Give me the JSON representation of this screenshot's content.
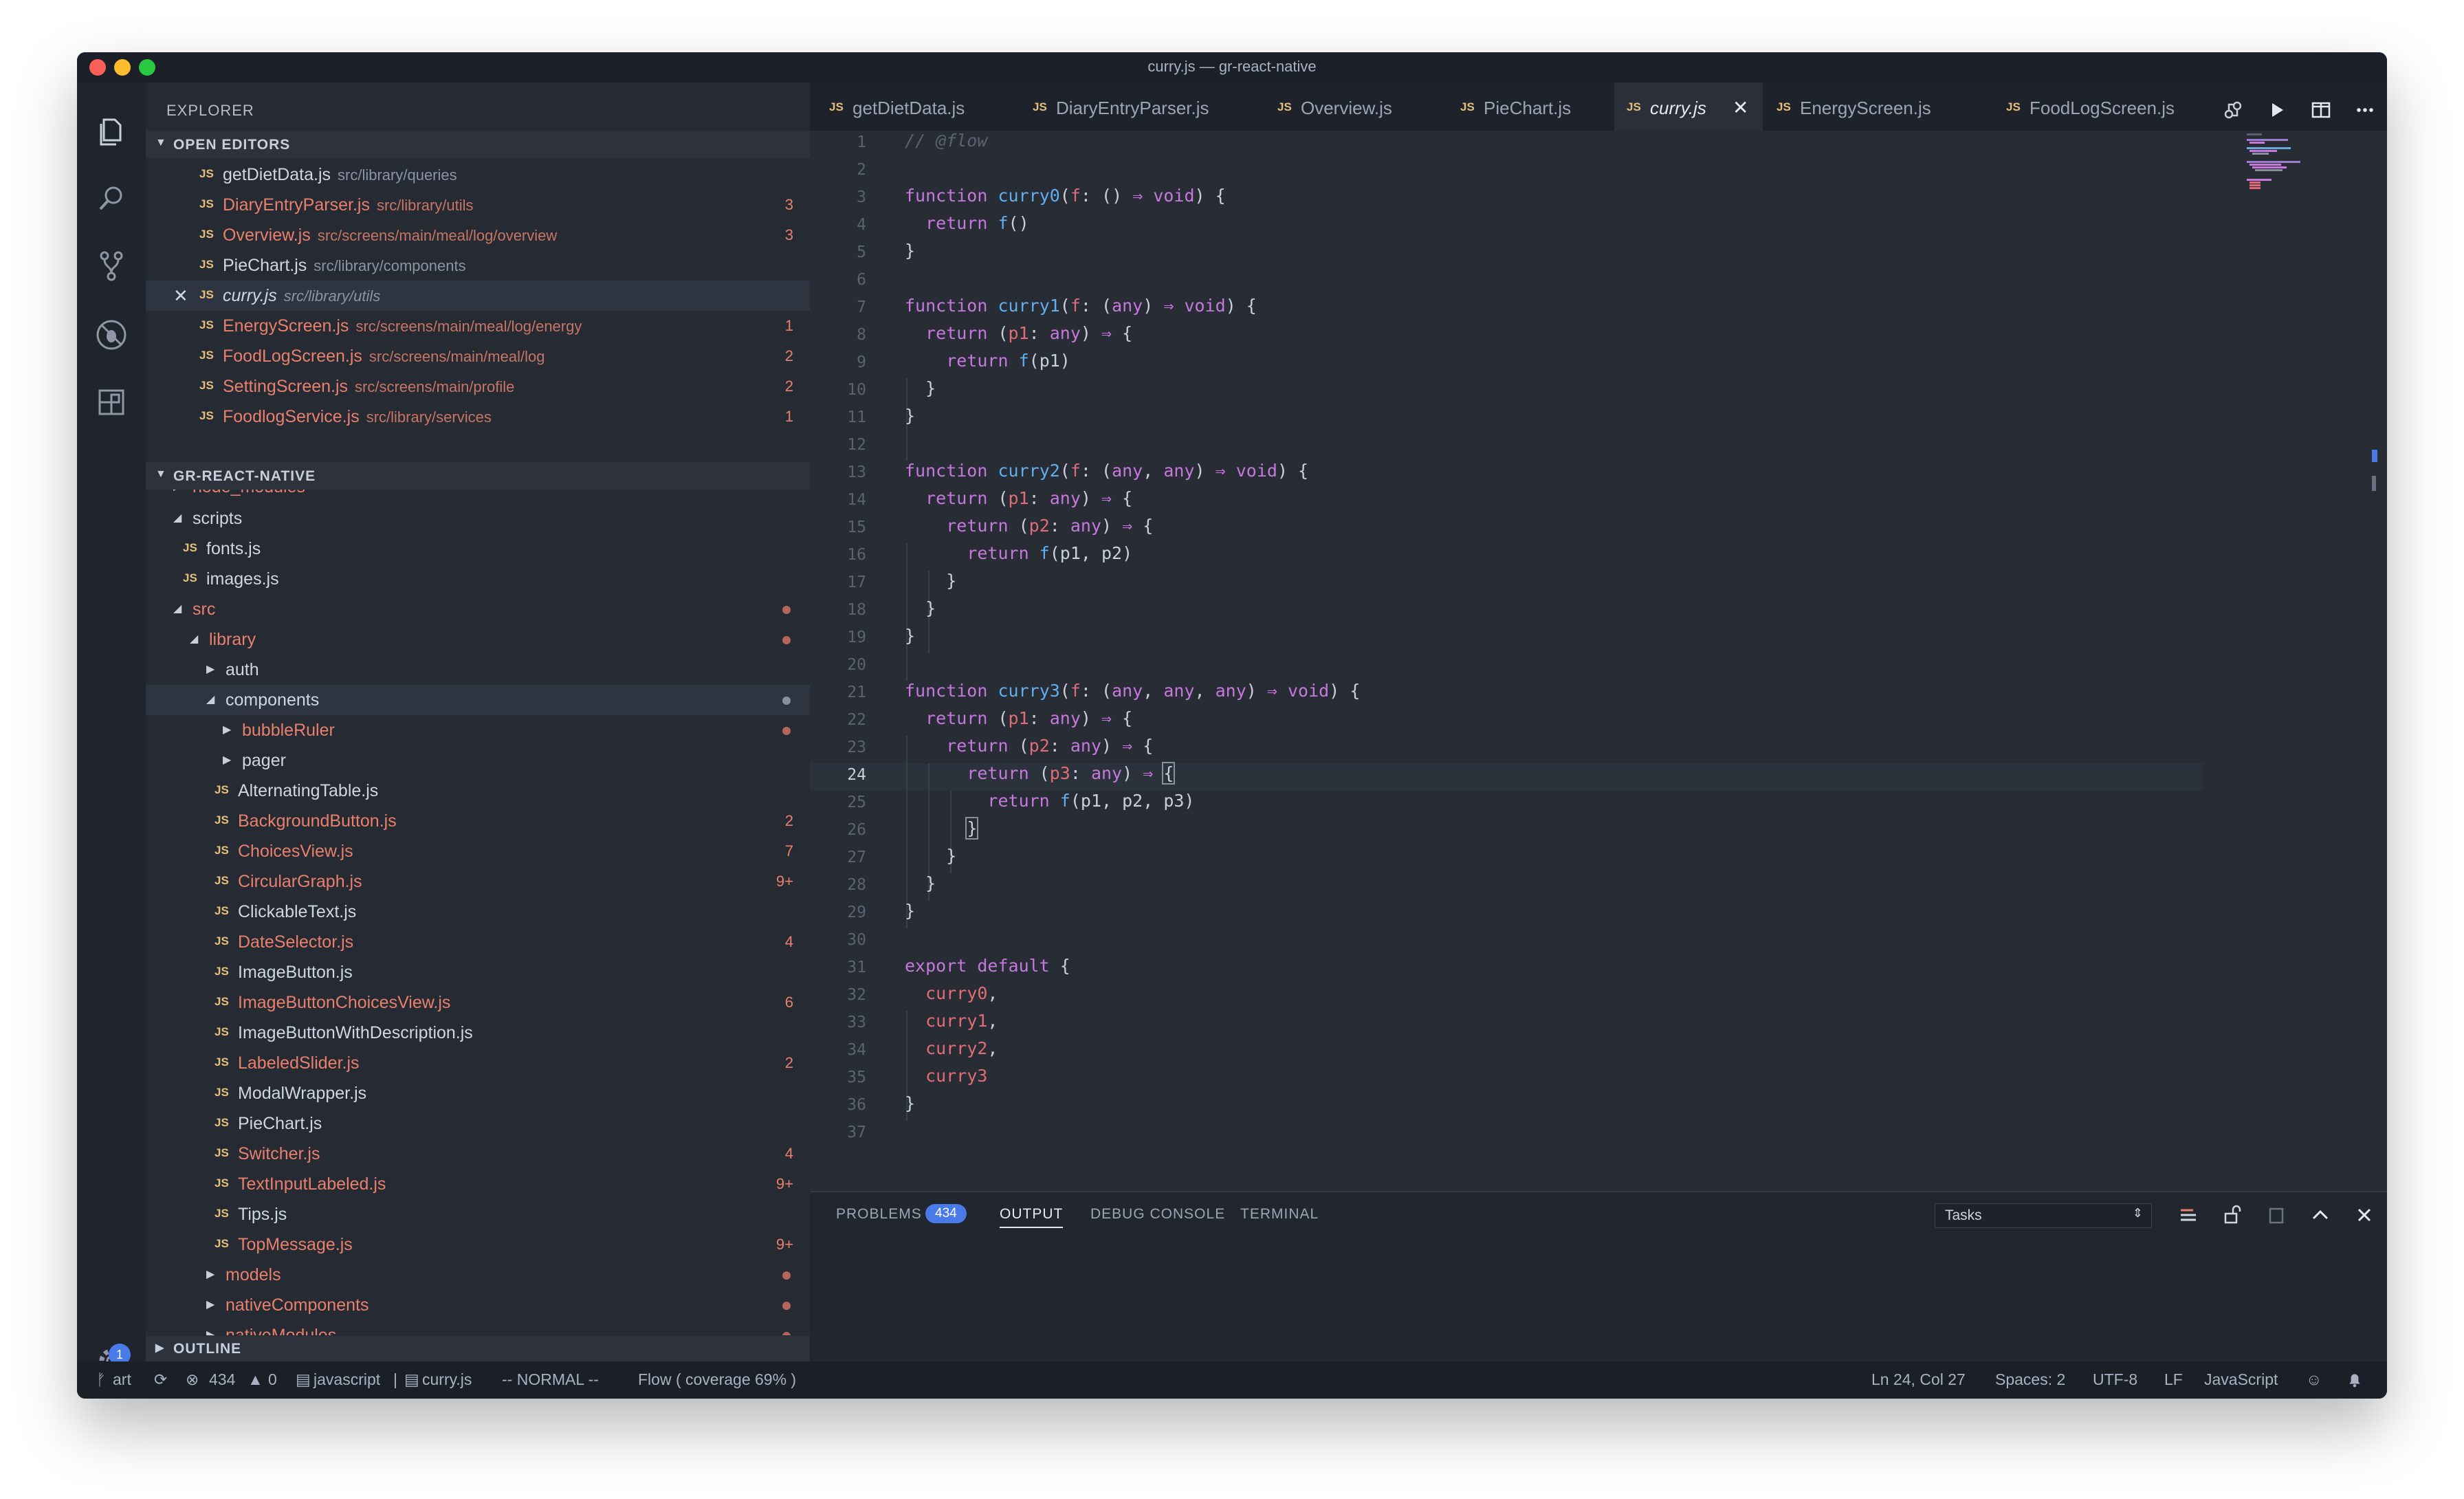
{
  "window": {
    "title": "curry.js — gr-react-native"
  },
  "colors": {
    "accent": "#4a7ae8",
    "modified": "#e8806d",
    "js_icon": "#e5c07b"
  },
  "activity_bar": {
    "icons": [
      "files-icon",
      "search-icon",
      "source-control-icon",
      "debug-icon",
      "extensions-icon"
    ],
    "settings_badge": "1"
  },
  "sidebar": {
    "header": "EXPLORER",
    "open_editors_label": "OPEN EDITORS",
    "open_editors": [
      {
        "name": "getDietData.js",
        "path": "src/library/queries",
        "badge": ""
      },
      {
        "name": "DiaryEntryParser.js",
        "path": "src/library/utils",
        "badge": "3"
      },
      {
        "name": "Overview.js",
        "path": "src/screens/main/meal/log/overview",
        "badge": "3"
      },
      {
        "name": "PieChart.js",
        "path": "src/library/components",
        "badge": ""
      },
      {
        "name": "curry.js",
        "path": "src/library/utils",
        "badge": ""
      },
      {
        "name": "EnergyScreen.js",
        "path": "src/screens/main/meal/log/energy",
        "badge": "1"
      },
      {
        "name": "FoodLogScreen.js",
        "path": "src/screens/main/meal/log",
        "badge": "2"
      },
      {
        "name": "SettingScreen.js",
        "path": "src/screens/main/profile",
        "badge": "2"
      },
      {
        "name": "FoodlogService.js",
        "path": "src/library/services",
        "badge": "1"
      }
    ],
    "project_label": "GR-REACT-NATIVE",
    "tree": [
      {
        "name": "node_modules",
        "badge": ""
      },
      {
        "name": "scripts",
        "badge": ""
      },
      {
        "name": "fonts.js",
        "badge": ""
      },
      {
        "name": "images.js",
        "badge": ""
      },
      {
        "name": "src",
        "badge": ""
      },
      {
        "name": "library",
        "badge": ""
      },
      {
        "name": "auth",
        "badge": ""
      },
      {
        "name": "components",
        "badge": ""
      },
      {
        "name": "bubbleRuler",
        "badge": ""
      },
      {
        "name": "pager",
        "badge": ""
      },
      {
        "name": "AlternatingTable.js",
        "badge": ""
      },
      {
        "name": "BackgroundButton.js",
        "badge": "2"
      },
      {
        "name": "ChoicesView.js",
        "badge": "7"
      },
      {
        "name": "CircularGraph.js",
        "badge": "9+"
      },
      {
        "name": "ClickableText.js",
        "badge": ""
      },
      {
        "name": "DateSelector.js",
        "badge": "4"
      },
      {
        "name": "ImageButton.js",
        "badge": ""
      },
      {
        "name": "ImageButtonChoicesView.js",
        "badge": "6"
      },
      {
        "name": "ImageButtonWithDescription.js",
        "badge": ""
      },
      {
        "name": "LabeledSlider.js",
        "badge": "2"
      },
      {
        "name": "ModalWrapper.js",
        "badge": ""
      },
      {
        "name": "PieChart.js",
        "badge": ""
      },
      {
        "name": "Switcher.js",
        "badge": "4"
      },
      {
        "name": "TextInputLabeled.js",
        "badge": "9+"
      },
      {
        "name": "Tips.js",
        "badge": ""
      },
      {
        "name": "TopMessage.js",
        "badge": "9+"
      },
      {
        "name": "models",
        "badge": ""
      },
      {
        "name": "nativeComponents",
        "badge": ""
      },
      {
        "name": "nativeModules",
        "badge": ""
      }
    ],
    "outline_label": "OUTLINE"
  },
  "tabs": [
    {
      "label": "getDietData.js"
    },
    {
      "label": "DiaryEntryParser.js"
    },
    {
      "label": "Overview.js"
    },
    {
      "label": "PieChart.js"
    },
    {
      "label": "curry.js",
      "close": "✕"
    },
    {
      "label": "EnergyScreen.js"
    },
    {
      "label": "FoodLogScreen.js"
    }
  ],
  "editor": {
    "current_line": "24",
    "line_numbers": [
      "1",
      "2",
      "3",
      "4",
      "5",
      "6",
      "7",
      "8",
      "9",
      "10",
      "11",
      "12",
      "13",
      "14",
      "15",
      "16",
      "17",
      "18",
      "19",
      "20",
      "21",
      "22",
      "23",
      "24",
      "25",
      "26",
      "27",
      "28",
      "29",
      "30",
      "31",
      "32",
      "33",
      "34",
      "35",
      "36",
      "37"
    ]
  },
  "panel": {
    "tabs": {
      "problems": "PROBLEMS",
      "output": "OUTPUT",
      "debug_console": "DEBUG CONSOLE",
      "terminal": "TERMINAL"
    },
    "problems_count": "434",
    "output_select": "Tasks"
  },
  "status": {
    "branch": "art",
    "errors": "434",
    "warnings": "0",
    "language_mode": "javascript",
    "file": "curry.js",
    "vim_mode": "-- NORMAL --",
    "flow": "Flow ( coverage 69% )",
    "position": "Ln 24, Col 27",
    "spaces": "Spaces: 2",
    "encoding": "UTF-8",
    "eol": "LF",
    "language": "JavaScript"
  }
}
